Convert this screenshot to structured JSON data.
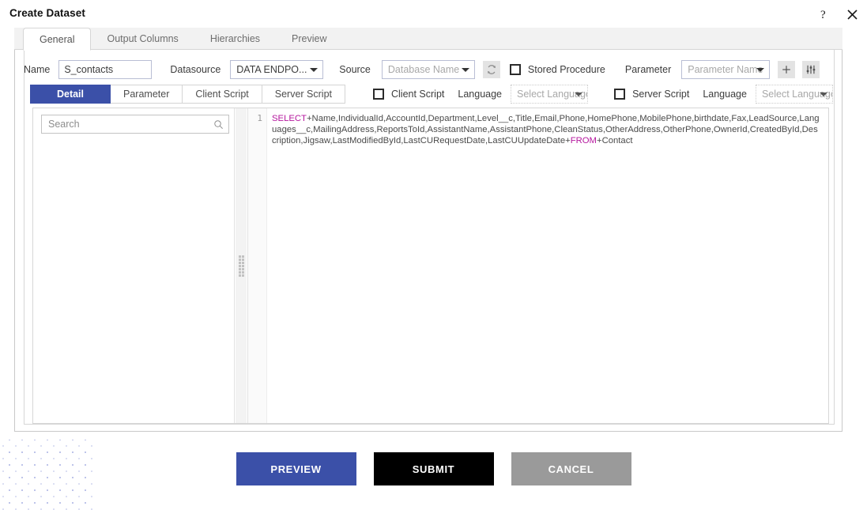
{
  "window": {
    "title": "Create Dataset",
    "help_icon": "question-mark-icon",
    "close_icon": "close-icon"
  },
  "colors": {
    "accent_blue": "#3b50a8",
    "submit_black": "#000000",
    "cancel_grey": "#9a9a9a",
    "keyword_purple": "#b5179e",
    "dot_pattern": "#b9bfe8"
  },
  "tabs": [
    {
      "label": "General",
      "active": true
    },
    {
      "label": "Output Columns",
      "active": false
    },
    {
      "label": "Hierarchies",
      "active": false
    },
    {
      "label": "Preview",
      "active": false
    }
  ],
  "form": {
    "name_label": "Name",
    "name_value": "S_contacts",
    "name_placeholder": "",
    "datasource_label": "Datasource",
    "datasource_value": "DATA ENDPO...",
    "source_label": "Source",
    "source_value": "Database Name",
    "refresh_icon": "refresh-icon",
    "stored_procedure_label": "Stored Procedure",
    "stored_procedure_checked": false,
    "parameter_label": "Parameter",
    "parameter_value": "Parameter Name",
    "add_icon": "plus-icon",
    "settings_icon": "sliders-icon"
  },
  "subtabs": [
    {
      "label": "Detail",
      "active": true
    },
    {
      "label": "Parameter",
      "active": false
    },
    {
      "label": "Client Script",
      "active": false
    },
    {
      "label": "Server Script",
      "active": false
    }
  ],
  "script_options": {
    "client_script_label": "Client Script",
    "client_script_checked": false,
    "client_language_label": "Language",
    "client_language_value": "Select Language",
    "server_script_label": "Server Script",
    "server_script_checked": false,
    "server_language_label": "Language",
    "server_language_value": "Select Language"
  },
  "left_pane": {
    "search_placeholder": "Search",
    "search_value": "",
    "search_icon": "search-icon"
  },
  "editor": {
    "line_number": "1",
    "keyword_select": "SELECT",
    "keyword_from": "FROM",
    "columns_part": "+Name,IndividualId,AccountId,Department,Level__c,Title,Email,Phone,HomePhone,MobilePhone,birthdate,Fax,LeadSource,Languages__c,MailingAddress,ReportsToId,AssistantName,AssistantPhone,CleanStatus,OtherAddress,OtherPhone,OwnerId,CreatedById,Description,Jigsaw,LastModifiedById,LastCURequestDate,LastCUUpdateDate+",
    "table_part": "+Contact"
  },
  "footer": {
    "preview_label": "PREVIEW",
    "submit_label": "SUBMIT",
    "cancel_label": "CANCEL"
  }
}
